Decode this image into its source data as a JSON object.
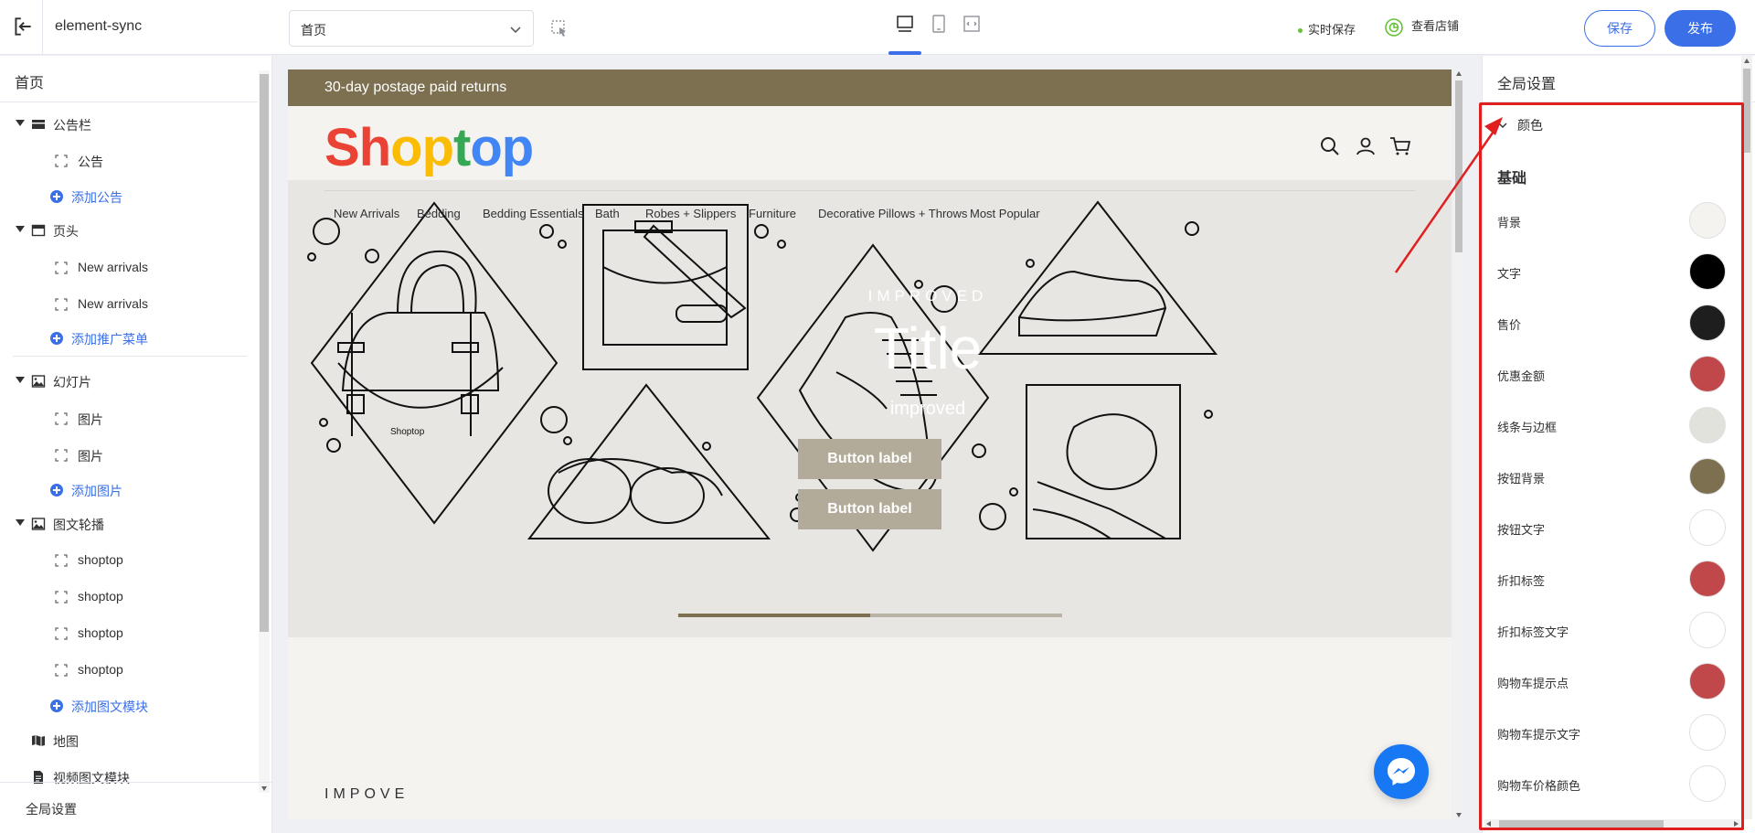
{
  "topbar": {
    "app_title": "element-sync",
    "page_select_value": "首页",
    "autosave_label": "实时保存",
    "view_store_label": "查看店铺",
    "save_label": "保存",
    "publish_label": "发布"
  },
  "sidebar": {
    "page_name": "首页",
    "items": [
      {
        "kind": "group",
        "icon": "announcement-icon",
        "label": "公告栏",
        "expanded": true
      },
      {
        "kind": "child",
        "label": "公告"
      },
      {
        "kind": "add",
        "label": "添加公告"
      },
      {
        "kind": "group",
        "icon": "header-icon",
        "label": "页头",
        "expanded": true
      },
      {
        "kind": "child",
        "label": "New arrivals"
      },
      {
        "kind": "child",
        "label": "New arrivals"
      },
      {
        "kind": "add",
        "label": "添加推广菜单"
      },
      {
        "kind": "group",
        "icon": "image-icon",
        "label": "幻灯片",
        "expanded": true
      },
      {
        "kind": "child",
        "label": "图片"
      },
      {
        "kind": "child",
        "label": "图片"
      },
      {
        "kind": "add",
        "label": "添加图片"
      },
      {
        "kind": "group",
        "icon": "image-icon",
        "label": "图文轮播",
        "expanded": true
      },
      {
        "kind": "child",
        "label": "shoptop"
      },
      {
        "kind": "child",
        "label": "shoptop"
      },
      {
        "kind": "child",
        "label": "shoptop"
      },
      {
        "kind": "child",
        "label": "shoptop"
      },
      {
        "kind": "add",
        "label": "添加图文模块"
      },
      {
        "kind": "group",
        "icon": "map-icon",
        "label": "地图",
        "expanded": false
      },
      {
        "kind": "group",
        "icon": "document-icon",
        "label": "视频图文模块",
        "expanded": false
      }
    ],
    "global_settings_label": "全局设置"
  },
  "preview": {
    "announcement": "30-day postage paid returns",
    "logo_text": "Shoptop",
    "logo_colors": [
      "#ea4335",
      "#ea4335",
      "#fbbc05",
      "#fbbc05",
      "#34a853",
      "#4285f4",
      "#4285f4"
    ],
    "nav": [
      "New Arrivals",
      "Bedding",
      "Bedding Essentials",
      "Bath",
      "Robes + Slippers",
      "Furniture",
      "Decorative Pillows + Throws",
      "Most Popular"
    ],
    "hero": {
      "eyebrow": "IMPROVED",
      "title": "Title",
      "subtitle": "improved",
      "button_1": "Button label",
      "button_2": "Button label"
    },
    "bag_label": "Shoptop",
    "slide_progress": 0.5,
    "section_heading": "IMPOVE",
    "accent": "#7c7051"
  },
  "right_panel": {
    "title": "全局设置",
    "accordion_label": "颜色",
    "section_title": "基础",
    "colors": [
      {
        "label": "背景",
        "value": "#f4f3f0"
      },
      {
        "label": "文字",
        "value": "#000000"
      },
      {
        "label": "售价",
        "value": "#1e1e1e"
      },
      {
        "label": "优惠金额",
        "value": "#c0474a"
      },
      {
        "label": "线条与边框",
        "value": "#e2e2dc"
      },
      {
        "label": "按钮背景",
        "value": "#7c7051"
      },
      {
        "label": "按钮文字",
        "value": "#ffffff"
      },
      {
        "label": "折扣标签",
        "value": "#c0474a"
      },
      {
        "label": "折扣标签文字",
        "value": "#ffffff"
      },
      {
        "label": "购物车提示点",
        "value": "#c0474a"
      },
      {
        "label": "购物车提示文字",
        "value": "#ffffff"
      },
      {
        "label": "购物车价格颜色",
        "value": "#ffffff"
      }
    ]
  }
}
